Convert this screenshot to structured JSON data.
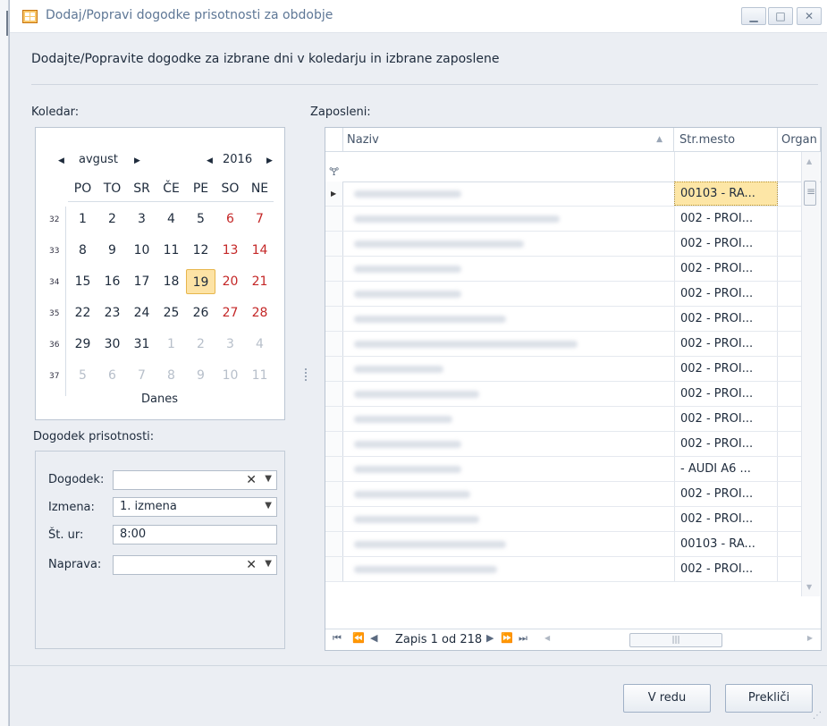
{
  "window": {
    "title": "Dodaj/Popravi dogodke prisotnosti za obdobje",
    "subtitle": "Dodajte/Popravite dogodke za izbrane dni v koledarju in izbrane zaposlene"
  },
  "labels": {
    "calendar": "Koledar:",
    "employees": "Zaposleni:",
    "event_group": "Dogodek prisotnosti:"
  },
  "calendar": {
    "month": "avgust",
    "year": "2016",
    "weekdays": [
      "PO",
      "TO",
      "SR",
      "ČE",
      "PE",
      "SO",
      "NE"
    ],
    "weeks": [
      {
        "n": "32",
        "days": [
          "1",
          "2",
          "3",
          "4",
          "5",
          "6",
          "7"
        ]
      },
      {
        "n": "33",
        "days": [
          "8",
          "9",
          "10",
          "11",
          "12",
          "13",
          "14"
        ]
      },
      {
        "n": "34",
        "days": [
          "15",
          "16",
          "17",
          "18",
          "19",
          "20",
          "21"
        ]
      },
      {
        "n": "35",
        "days": [
          "22",
          "23",
          "24",
          "25",
          "26",
          "27",
          "28"
        ]
      },
      {
        "n": "36",
        "days": [
          "29",
          "30",
          "31",
          "1",
          "2",
          "3",
          "4"
        ]
      },
      {
        "n": "37",
        "days": [
          "5",
          "6",
          "7",
          "8",
          "9",
          "10",
          "11"
        ]
      }
    ],
    "today_label": "Danes"
  },
  "form": {
    "event_label": "Dogodek:",
    "event_value": "",
    "shift_label": "Izmena:",
    "shift_value": "1. izmena",
    "hours_label": "Št. ur:",
    "hours_value": "8:00",
    "device_label": "Naprava:",
    "device_value": ""
  },
  "grid": {
    "columns": [
      "Naziv",
      "Str.mesto",
      "Organ"
    ],
    "rows": [
      {
        "place": "00103 - RA...",
        "selected": true
      },
      {
        "place": "002 - PROI..."
      },
      {
        "place": "002 - PROI..."
      },
      {
        "place": "002 - PROI..."
      },
      {
        "place": "002 - PROI..."
      },
      {
        "place": "002 - PROI..."
      },
      {
        "place": "002 - PROI..."
      },
      {
        "place": "002 - PROI..."
      },
      {
        "place": "002 - PROI..."
      },
      {
        "place": "002 - PROI..."
      },
      {
        "place": "002 - PROI..."
      },
      {
        "place": "- AUDI A6 ..."
      },
      {
        "place": "002 - PROI..."
      },
      {
        "place": "002 - PROI..."
      },
      {
        "place": "00103 - RA..."
      },
      {
        "place": "002 - PROI..."
      }
    ],
    "pager_text": "Zapis 1 od 218"
  },
  "buttons": {
    "ok": "V redu",
    "cancel": "Prekliči"
  },
  "colors": {
    "weekend": "#c42727",
    "selection": "#fde6a6",
    "window_bg": "#ebeef3"
  }
}
